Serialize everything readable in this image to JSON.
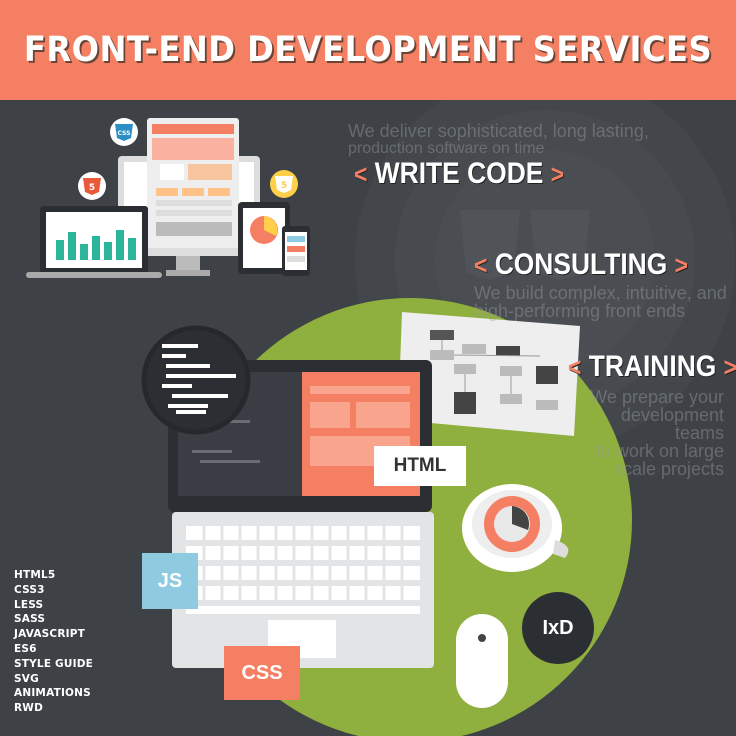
{
  "header": {
    "title": "FRONT-END DEVELOPMENT SERVICES"
  },
  "services": [
    {
      "label": "WRITE CODE",
      "description_lines": [
        "We deliver sophisticated, long lasting,",
        "production software on time"
      ]
    },
    {
      "label": "CONSULTING",
      "description_lines": [
        "We build complex, intuitive, and",
        "high-performing front ends"
      ]
    },
    {
      "label": "TRAINING",
      "description_lines": [
        "We prepare your",
        "development teams",
        "to work on large",
        "scale projects"
      ]
    }
  ],
  "bracket_open": "<",
  "bracket_close": ">",
  "badges": {
    "html": "HTML",
    "js": "JS",
    "css": "CSS",
    "ixd": "IxD"
  },
  "device_icons": {
    "css3": "CSS",
    "html5": "5",
    "html5_small": "HTML",
    "html5_yellow": "5"
  },
  "technologies": [
    "HTML5",
    "CSS3",
    "LESS",
    "SASS",
    "JAVASCRIPT",
    "ES6",
    "STYLE GUIDE",
    "SVG",
    "ANIMATIONS",
    "RWD"
  ],
  "colors": {
    "banner": "#f47f62",
    "background": "#3e4247",
    "green_circle": "#8fb03e",
    "accent_orange": "#f47f62",
    "js_blue": "#8fcbe0",
    "chart_teal": "#2bb59a"
  }
}
